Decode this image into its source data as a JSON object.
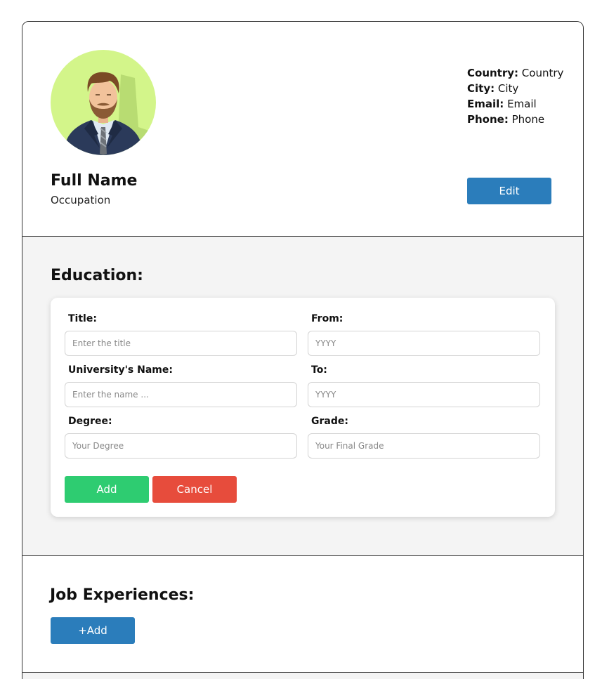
{
  "profile": {
    "full_name": "Full Name",
    "occupation": "Occupation",
    "avatar_bg_color": "#d3f58a",
    "contact": [
      {
        "label": "Country:",
        "value": "Country"
      },
      {
        "label": "City:",
        "value": "City"
      },
      {
        "label": "Email:",
        "value": "Email"
      },
      {
        "label": "Phone:",
        "value": "Phone"
      }
    ],
    "edit_label": "Edit"
  },
  "education": {
    "title": "Education:",
    "fields": {
      "title": {
        "label": "Title:",
        "placeholder": "Enter the title"
      },
      "university": {
        "label": "University's Name:",
        "placeholder": "Enter the name ..."
      },
      "degree": {
        "label": "Degree:",
        "placeholder": "Your Degree"
      },
      "from": {
        "label": "From:",
        "placeholder": "YYYY"
      },
      "to": {
        "label": "To:",
        "placeholder": "YYYY"
      },
      "grade": {
        "label": "Grade:",
        "placeholder": "Your Final Grade"
      }
    },
    "add_label": "Add",
    "cancel_label": "Cancel"
  },
  "jobs": {
    "title": "Job Experiences:",
    "add_label": "+Add"
  },
  "colors": {
    "primary": "#2b7dbb",
    "success": "#2ecc71",
    "danger": "#e74c3c"
  }
}
